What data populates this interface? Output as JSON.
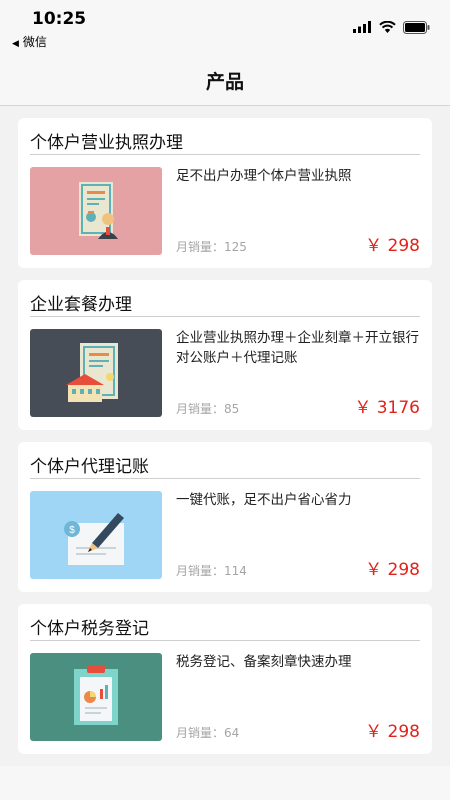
{
  "status_bar": {
    "time": "10:25",
    "back_label": "微信",
    "back_arrow_icon": "back-triangle-icon"
  },
  "nav": {
    "title": "产品"
  },
  "colors": {
    "price": "#e0241b",
    "sales": "#a5a5a5"
  },
  "products": [
    {
      "title": "个体户营业执照办理",
      "description": "足不出户办理个体户营业执照",
      "sales_label": "月销量：",
      "sales_count": "125",
      "price": "￥ 298",
      "thumb_icon": "business-license-icon",
      "thumb_bg": "#e5a2a5"
    },
    {
      "title": "企业套餐办理",
      "description": "企业营业执照办理＋企业刻章＋开立银行对公账户＋代理记账",
      "sales_label": "月销量：",
      "sales_count": "85",
      "price": "￥ 3176",
      "thumb_icon": "enterprise-package-icon",
      "thumb_bg": "#474d57"
    },
    {
      "title": "个体户代理记账",
      "description": "一键代账，足不出户省心省力",
      "sales_label": "月销量：",
      "sales_count": "114",
      "price": "￥ 298",
      "thumb_icon": "bookkeeping-pen-icon",
      "thumb_bg": "#9fd6f5"
    },
    {
      "title": "个体户税务登记",
      "description": "税务登记、备案刻章快速办理",
      "sales_label": "月销量：",
      "sales_count": "64",
      "price": "￥ 298",
      "thumb_icon": "tax-clipboard-icon",
      "thumb_bg": "#4a8f7f"
    }
  ]
}
